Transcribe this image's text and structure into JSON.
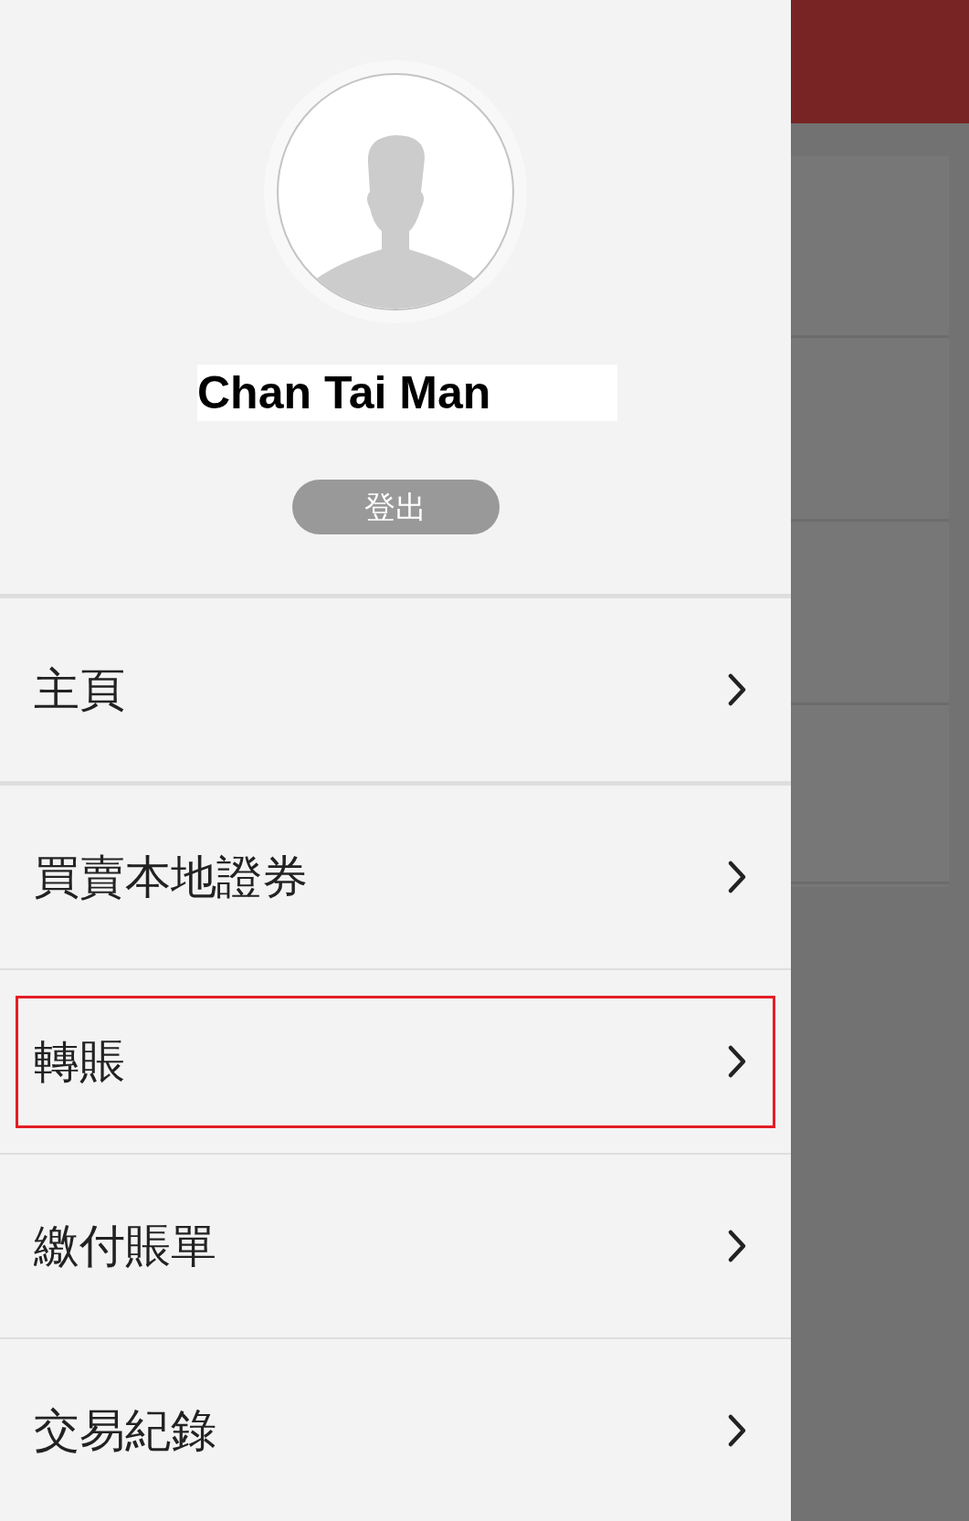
{
  "profile": {
    "name": "Chan Tai Man",
    "logout_button": "登出"
  },
  "menu": {
    "items": [
      {
        "label": "主頁",
        "highlighted": false
      },
      {
        "label": "買賣本地證券",
        "highlighted": false
      },
      {
        "label": "轉賬",
        "highlighted": true
      },
      {
        "label": "繳付賬單",
        "highlighted": false
      },
      {
        "label": "交易紀錄",
        "highlighted": false
      }
    ]
  }
}
